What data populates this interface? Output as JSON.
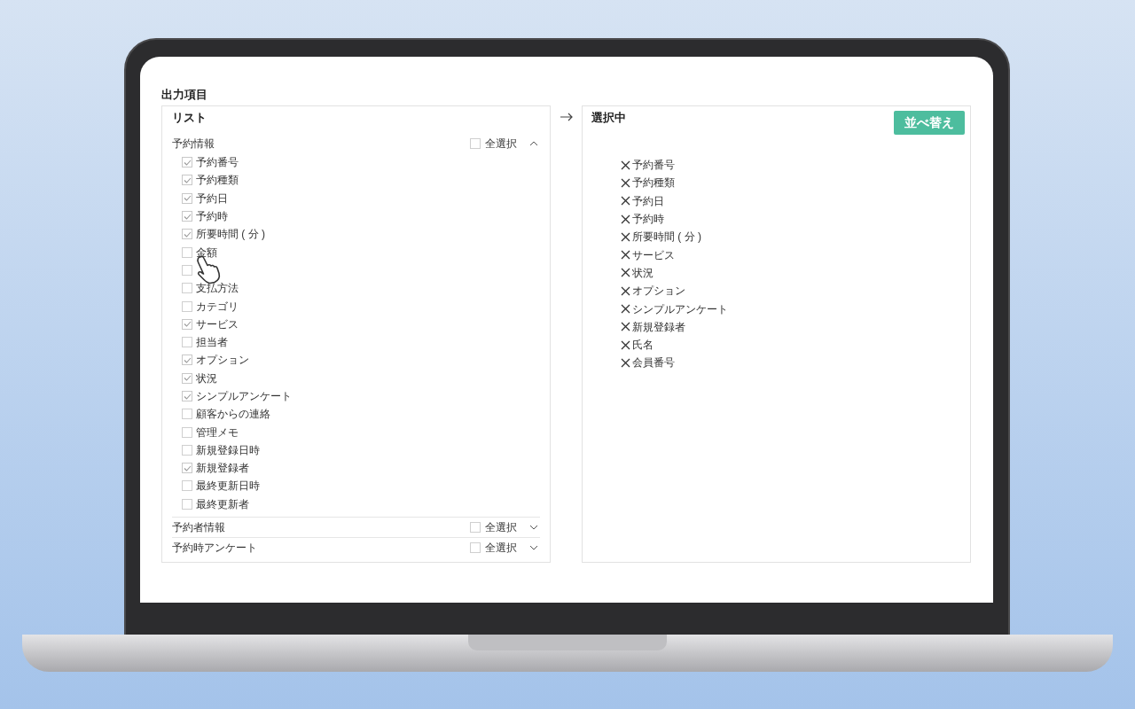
{
  "title": "出力項目",
  "list_panel": {
    "title": "リスト",
    "groups": [
      {
        "label": "予約情報",
        "select_all_label": "全選択",
        "select_all_checked": false,
        "expanded": true,
        "items": [
          {
            "label": "予約番号",
            "checked": true
          },
          {
            "label": "予約種類",
            "checked": true
          },
          {
            "label": "予約日",
            "checked": true
          },
          {
            "label": "予約時",
            "checked": true
          },
          {
            "label": "所要時間 ( 分 )",
            "checked": true
          },
          {
            "label": "金額",
            "checked": false
          },
          {
            "checked": false
          },
          {
            "label": "支払方法",
            "checked": false
          },
          {
            "label": "カテゴリ",
            "checked": false
          },
          {
            "label": "サービス",
            "checked": true
          },
          {
            "label": "担当者",
            "checked": false
          },
          {
            "label": "オプション",
            "checked": true
          },
          {
            "label": "状況",
            "checked": true
          },
          {
            "label": "シンプルアンケート",
            "checked": true
          },
          {
            "label": "顧客からの連絡",
            "checked": false
          },
          {
            "label": "管理メモ",
            "checked": false
          },
          {
            "label": "新規登録日時",
            "checked": false
          },
          {
            "label": "新規登録者",
            "checked": true
          },
          {
            "label": "最終更新日時",
            "checked": false
          },
          {
            "label": "最終更新者",
            "checked": false
          }
        ]
      },
      {
        "label": "予約者情報",
        "select_all_label": "全選択",
        "select_all_checked": false,
        "expanded": false
      },
      {
        "label": "予約時アンケート",
        "select_all_label": "全選択",
        "select_all_checked": false,
        "expanded": false
      }
    ]
  },
  "selected_panel": {
    "title": "選択中",
    "sort_button": "並べ替え",
    "items": [
      "予約番号",
      "予約種類",
      "予約日",
      "予約時",
      "所要時間 ( 分 )",
      "サービス",
      "状況",
      "オプション",
      "シンプルアンケート",
      "新規登録者",
      "氏名",
      "会員番号"
    ]
  }
}
